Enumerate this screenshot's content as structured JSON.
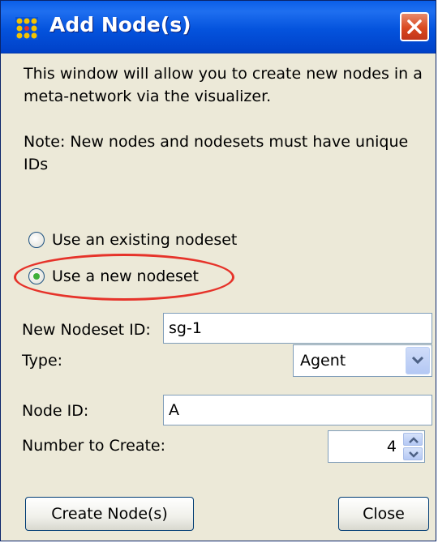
{
  "window": {
    "title": "Add Node(s)",
    "title_bar_color": "#0453dd",
    "icons": {
      "app": "network-nodes-icon",
      "close": "close-icon"
    }
  },
  "description": "This window will allow you to create new nodes in a meta-network via the visualizer.",
  "note": "Note: New nodes and nodesets must have unique IDs",
  "nodeset_options": [
    {
      "label": "Use an existing nodeset",
      "selected": false
    },
    {
      "label": "Use a new nodeset",
      "selected": true
    }
  ],
  "highlight_color": "#e6332a",
  "form": {
    "nodeset_id": {
      "label": "New Nodeset ID:",
      "value": "sg-1"
    },
    "type": {
      "label": "Type:",
      "value": "Agent"
    },
    "node_id": {
      "label": "Node ID:",
      "value": "A"
    },
    "number_to_create": {
      "label": "Number to Create:",
      "value": "4"
    }
  },
  "buttons": {
    "create": "Create Node(s)",
    "close": "Close"
  }
}
